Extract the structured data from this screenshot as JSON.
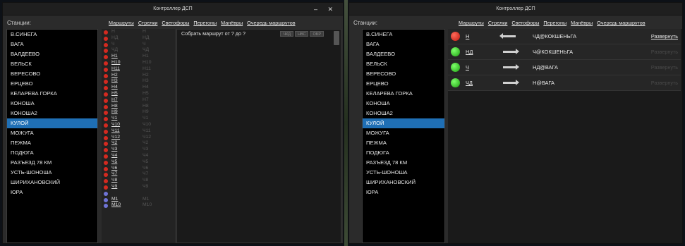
{
  "left_window": {
    "title": "Контроллер ДСП",
    "controls": "– ✕",
    "stations_label": "Станции:",
    "tabs": [
      "Маршруты",
      "Стрелки",
      "Светофоры",
      "Перегоны",
      "Манёвры",
      "Очередь маршрутов"
    ],
    "stations": [
      "В.СИНЕГА",
      "ВАГА",
      "ВАЛДЕЕВО",
      "ВЕЛЬСК",
      "ВЕРЕСОВО",
      "ЕРЦЕВО",
      "КЕЛАРЕВА ГОРКА",
      "КОНОША",
      "КОНОША2",
      "КУЛОЙ",
      "МОЖУГА",
      "ПЕЖМА",
      "ПОДЮГА",
      "РАЗЪЕЗД 78 КМ",
      "УСТЬ-ШОНОША",
      "ШИРИХАНОВСКИЙ",
      "ЮРА"
    ],
    "selected_station": "КУЛОЙ",
    "signals": [
      {
        "name": "Н",
        "ghost": "Н",
        "dot": "red",
        "active": false
      },
      {
        "name": "НД",
        "ghost": "НД",
        "dot": "red",
        "active": false
      },
      {
        "name": "Ч",
        "ghost": "Ч",
        "dot": "red",
        "active": false
      },
      {
        "name": "ЧД",
        "ghost": "ЧД",
        "dot": "red",
        "active": false
      },
      {
        "name": "Н1",
        "ghost": "Н1",
        "dot": "red",
        "active": true
      },
      {
        "name": "Н10",
        "ghost": "Н10",
        "dot": "red",
        "active": true
      },
      {
        "name": "Н11",
        "ghost": "Н11",
        "dot": "red",
        "active": true
      },
      {
        "name": "Н2",
        "ghost": "Н2",
        "dot": "red",
        "active": true
      },
      {
        "name": "Н3",
        "ghost": "Н3",
        "dot": "red",
        "active": true
      },
      {
        "name": "Н4",
        "ghost": "Н4",
        "dot": "red",
        "active": true
      },
      {
        "name": "Н5",
        "ghost": "Н5",
        "dot": "red",
        "active": true
      },
      {
        "name": "Н7",
        "ghost": "Н7",
        "dot": "red",
        "active": true
      },
      {
        "name": "Н8",
        "ghost": "Н8",
        "dot": "red",
        "active": true
      },
      {
        "name": "Н9",
        "ghost": "Н9",
        "dot": "red",
        "active": true
      },
      {
        "name": "Ч1",
        "ghost": "Ч1",
        "dot": "red",
        "active": true
      },
      {
        "name": "Ч10",
        "ghost": "Ч10",
        "dot": "red",
        "active": true
      },
      {
        "name": "Ч11",
        "ghost": "Ч11",
        "dot": "red",
        "active": true
      },
      {
        "name": "Ч12",
        "ghost": "Ч12",
        "dot": "red",
        "active": true
      },
      {
        "name": "Ч2",
        "ghost": "Ч2",
        "dot": "red",
        "active": true
      },
      {
        "name": "Ч3",
        "ghost": "Ч3",
        "dot": "red",
        "active": true
      },
      {
        "name": "Ч4",
        "ghost": "Ч4",
        "dot": "red",
        "active": true
      },
      {
        "name": "Ч5",
        "ghost": "Ч5",
        "dot": "red",
        "active": true
      },
      {
        "name": "Ч6",
        "ghost": "Ч6",
        "dot": "red",
        "active": true
      },
      {
        "name": "Ч7",
        "ghost": "Ч7",
        "dot": "red",
        "active": true
      },
      {
        "name": "Ч8",
        "ghost": "Ч8",
        "dot": "red",
        "active": true
      },
      {
        "name": "Ч9",
        "ghost": "Ч9",
        "dot": "red",
        "active": true
      },
      {
        "name": "",
        "ghost": "",
        "dot": "blue",
        "active": false
      },
      {
        "name": "М1",
        "ghost": "М1",
        "dot": "blue",
        "active": true
      },
      {
        "name": "М10",
        "ghost": "М10",
        "dot": "blue",
        "active": true
      }
    ],
    "route_prompt": "Собрать маршрут от ? до ?",
    "route_buttons": [
      "ЧКД",
      "НВС",
      "ОБР"
    ]
  },
  "right_window": {
    "title": "Контроллер ДСП",
    "stations_label": "Станции:",
    "tabs": [
      "Маршруты",
      "Стрелки",
      "Светофоры",
      "Перегоны",
      "Манёвры",
      "Очередь маршрутов"
    ],
    "stations": [
      "В.СИНЕГА",
      "ВАГА",
      "ВАЛДЕЕВО",
      "ВЕЛЬСК",
      "ВЕРЕСОВО",
      "ЕРЦЕВО",
      "КЕЛАРЕВА ГОРКА",
      "КОНОША",
      "КОНОША2",
      "КУЛОЙ",
      "МОЖУГА",
      "ПЕЖМА",
      "ПОДЮГА",
      "РАЗЪЕЗД 78 КМ",
      "УСТЬ-ШОНОША",
      "ШИРИХАНОВСКИЙ",
      "ЮРА"
    ],
    "selected_station": "КУЛОЙ",
    "routes": [
      {
        "signal": "Н",
        "lamp": "red",
        "direction": "left",
        "dest": "ЧД@КОКШЕНЬГА",
        "action": "Развернуть",
        "action_enabled": true
      },
      {
        "signal": "НД",
        "lamp": "green",
        "direction": "right",
        "dest": "Ч@КОКШЕНЬГА",
        "action": "Развернуть",
        "action_enabled": false
      },
      {
        "signal": "Ч",
        "lamp": "green",
        "direction": "right",
        "dest": "НД@ВАГА",
        "action": "Развернуть",
        "action_enabled": false
      },
      {
        "signal": "ЧД",
        "lamp": "green",
        "direction": "right",
        "dest": "Н@ВАГА",
        "action": "Развернуть",
        "action_enabled": false
      }
    ]
  },
  "colors": {
    "selection": "#1f6fb5",
    "signal_red": "#d42a20",
    "signal_blue": "#6f74d6",
    "lamp_green": "#1ea012"
  }
}
